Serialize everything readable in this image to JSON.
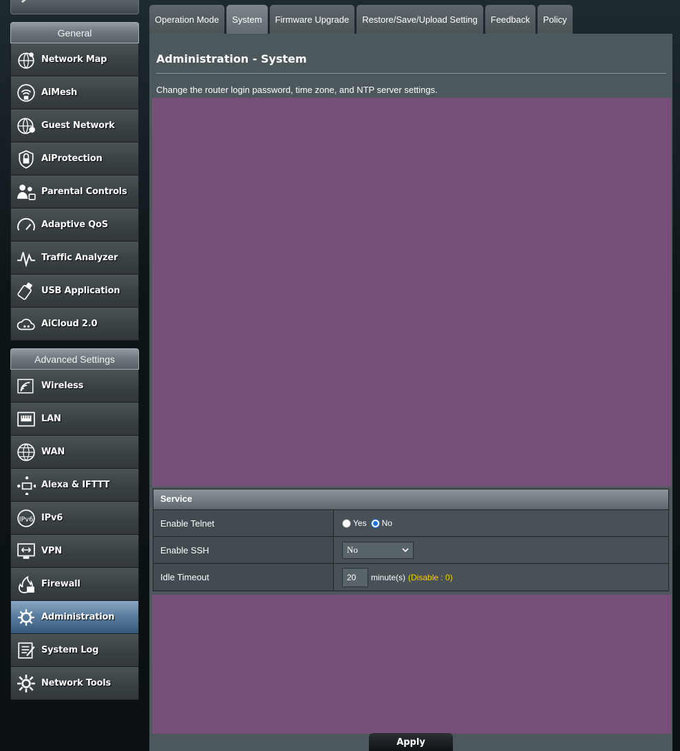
{
  "sidebar": {
    "general_header": "General",
    "general_items": [
      {
        "label": "Network Map",
        "icon": "network-map-icon"
      },
      {
        "label": "AiMesh",
        "icon": "aimesh-icon"
      },
      {
        "label": "Guest Network",
        "icon": "guest-network-icon"
      },
      {
        "label": "AiProtection",
        "icon": "aiprotection-icon"
      },
      {
        "label": "Parental Controls",
        "icon": "parental-controls-icon"
      },
      {
        "label": "Adaptive QoS",
        "icon": "adaptive-qos-icon"
      },
      {
        "label": "Traffic Analyzer",
        "icon": "traffic-analyzer-icon"
      },
      {
        "label": "USB Application",
        "icon": "usb-application-icon"
      },
      {
        "label": "AiCloud 2.0",
        "icon": "aicloud-icon"
      }
    ],
    "advanced_header": "Advanced Settings",
    "advanced_items": [
      {
        "label": "Wireless",
        "icon": "wireless-icon"
      },
      {
        "label": "LAN",
        "icon": "lan-icon"
      },
      {
        "label": "WAN",
        "icon": "wan-icon"
      },
      {
        "label": "Alexa & IFTTT",
        "icon": "alexa-ifttt-icon"
      },
      {
        "label": "IPv6",
        "icon": "ipv6-icon"
      },
      {
        "label": "VPN",
        "icon": "vpn-icon"
      },
      {
        "label": "Firewall",
        "icon": "firewall-icon"
      },
      {
        "label": "Administration",
        "icon": "administration-icon",
        "active": true
      },
      {
        "label": "System Log",
        "icon": "system-log-icon"
      },
      {
        "label": "Network Tools",
        "icon": "network-tools-icon"
      }
    ]
  },
  "tabs": [
    {
      "label": "Operation Mode"
    },
    {
      "label": "System",
      "active": true
    },
    {
      "label": "Firmware Upgrade"
    },
    {
      "label": "Restore/Save/Upload Setting"
    },
    {
      "label": "Feedback"
    },
    {
      "label": "Policy"
    }
  ],
  "main": {
    "title": "Administration - System",
    "description": "Change the router login password, time zone, and NTP server settings."
  },
  "service": {
    "header": "Service",
    "telnet": {
      "label": "Enable Telnet",
      "yes_label": "Yes",
      "no_label": "No",
      "selected": "No"
    },
    "ssh": {
      "label": "Enable SSH",
      "value": "No"
    },
    "idle": {
      "label": "Idle Timeout",
      "value": "20",
      "unit": "minute(s)",
      "hint": "(Disable : 0)"
    }
  },
  "apply_label": "Apply",
  "colors": {
    "accent_yellow": "#ffcc00",
    "purple_area": "#77507a",
    "active_menu": "#5a7ea0"
  }
}
